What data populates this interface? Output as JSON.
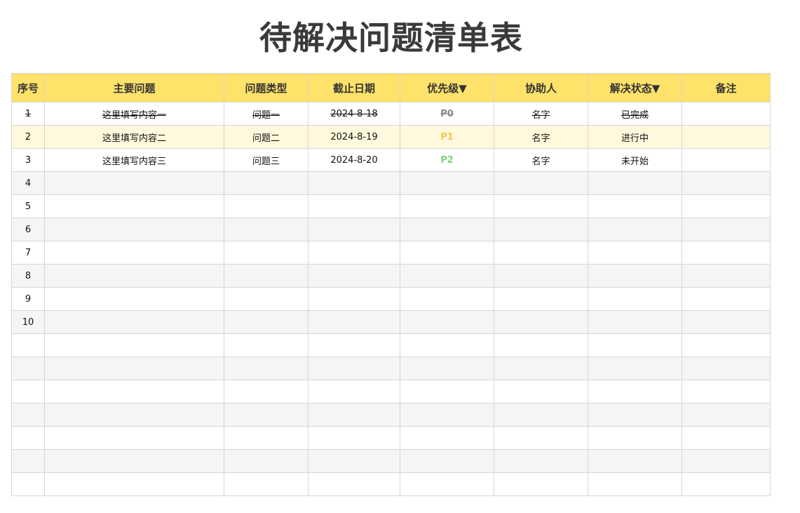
{
  "title": "待解决问题清单表",
  "headers": [
    "序号",
    "主要问题",
    "问题类型",
    "截止日期",
    "优先级▼",
    "协助人",
    "解决状态▼",
    "备注"
  ],
  "priority_colors": {
    "P0": "#8a8a8a",
    "P1": "#f2c94c",
    "P2": "#7dd67a"
  },
  "rows": [
    {
      "no": "1",
      "issue": "这里填写内容一",
      "type": "问题一",
      "due": "2024-8-18",
      "priority": "P0",
      "helper": "名字",
      "status": "已完成",
      "note": "",
      "done": true
    },
    {
      "no": "2",
      "issue": "这里填写内容二",
      "type": "问题二",
      "due": "2024-8-19",
      "priority": "P1",
      "helper": "名字",
      "status": "进行中",
      "note": ""
    },
    {
      "no": "3",
      "issue": "这里填写内容三",
      "type": "问题三",
      "due": "2024-8-20",
      "priority": "P2",
      "helper": "名字",
      "status": "未开始",
      "note": ""
    },
    {
      "no": "4"
    },
    {
      "no": "5"
    },
    {
      "no": "6"
    },
    {
      "no": "7"
    },
    {
      "no": "8"
    },
    {
      "no": "9"
    },
    {
      "no": "10"
    },
    {},
    {},
    {},
    {},
    {},
    {},
    {}
  ]
}
